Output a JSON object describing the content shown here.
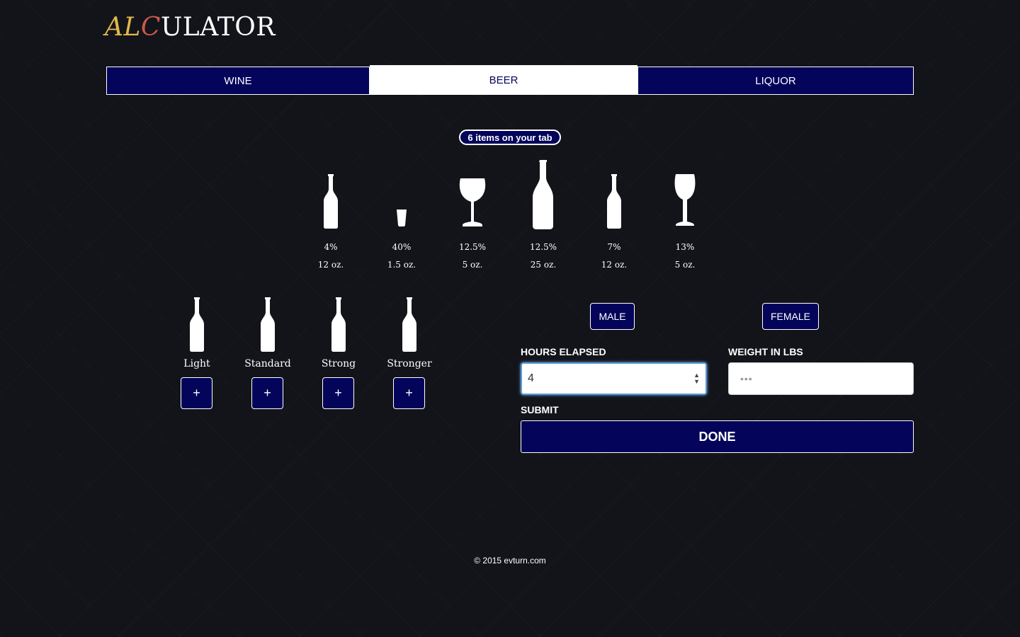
{
  "header": {
    "logo_part1": "AL",
    "logo_part2": "C",
    "logo_part3": "ULATOR"
  },
  "tabs": [
    {
      "label": "WINE",
      "active": false
    },
    {
      "label": "BEER",
      "active": true
    },
    {
      "label": "LIQUOR",
      "active": false
    }
  ],
  "tab_summary": {
    "badge": "6 items on your tab"
  },
  "tab_items": [
    {
      "icon": "beer-bottle-icon",
      "abv": "4%",
      "volume": "12 oz."
    },
    {
      "icon": "shot-glass-icon",
      "abv": "40%",
      "volume": "1.5 oz."
    },
    {
      "icon": "wine-glass-icon",
      "abv": "12.5%",
      "volume": "5 oz."
    },
    {
      "icon": "wine-bottle-icon",
      "abv": "12.5%",
      "volume": "25 oz."
    },
    {
      "icon": "beer-bottle-icon",
      "abv": "7%",
      "volume": "12 oz."
    },
    {
      "icon": "wine-glass-icon",
      "abv": "13%",
      "volume": "5 oz."
    }
  ],
  "beer_choices": [
    {
      "label": "Light",
      "button": "+"
    },
    {
      "label": "Standard",
      "button": "+"
    },
    {
      "label": "Strong",
      "button": "+"
    },
    {
      "label": "Stronger",
      "button": "+"
    }
  ],
  "form": {
    "male_label": "MALE",
    "female_label": "FEMALE",
    "hours_label": "HOURS ELAPSED",
    "hours_value": "4",
    "weight_label": "WEIGHT IN LBS",
    "weight_value": "•••",
    "submit_label": "SUBMIT",
    "done_label": "DONE"
  },
  "footer": {
    "copyright": "© 2015 evturn.com"
  },
  "colors": {
    "accent": "#03045a",
    "logo_gold": "#e0b84c",
    "logo_red": "#c85a4a"
  }
}
